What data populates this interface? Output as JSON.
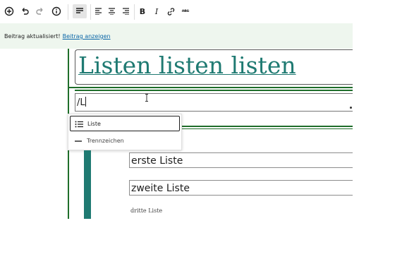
{
  "toolbar": {
    "add": "⊕",
    "undo": "↶",
    "redo": "↷",
    "info": "ⓘ",
    "bold": "B",
    "italic": "I",
    "link": "🔗",
    "strike": "ABC"
  },
  "notice": {
    "text": "Beitrag aktualisiert!",
    "link": "Beitrag anzeigen"
  },
  "editor": {
    "title": "Listen listen listen",
    "input_value": "/L",
    "slash_menu": [
      {
        "label": "Liste",
        "icon": "list-icon",
        "selected": true
      },
      {
        "label": "Trennzeichen",
        "icon": "separator-icon",
        "selected": false
      }
    ],
    "list_items": [
      "erste Liste",
      "zweite Liste"
    ],
    "list_item_small": "dritte Liste"
  },
  "colors": {
    "accent_green": "#1f6e2a",
    "teal": "#1f7a72",
    "notice_bg": "#eef6ee",
    "link": "#0a66a7"
  }
}
